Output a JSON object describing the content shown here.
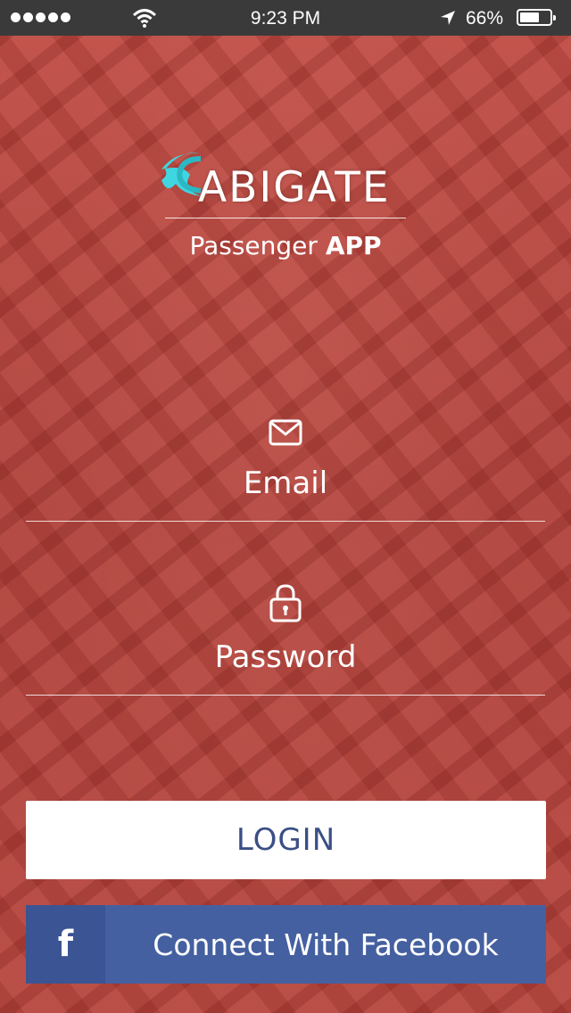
{
  "status_bar": {
    "time": "9:23 PM",
    "battery_percent": "66%",
    "battery_level": 0.66,
    "signal_icon": "signal-dots-icon",
    "wifi_icon": "wifi-icon",
    "location_icon": "location-arrow-icon"
  },
  "brand": {
    "logo_text": "ABIGATE",
    "logo_c_color": "#3fd6e0",
    "subtitle_regular": "Passenger ",
    "subtitle_bold": "APP"
  },
  "form": {
    "email": {
      "label": "Email",
      "icon": "envelope-icon"
    },
    "password": {
      "label": "Password",
      "icon": "lock-icon"
    }
  },
  "actions": {
    "login_label": "LOGIN",
    "facebook_icon_glyph": "f",
    "facebook_label": "Connect With Facebook"
  },
  "colors": {
    "background": "#b5453d",
    "login_text": "#3b4f85",
    "facebook": "#4560a0",
    "facebook_dark": "#3b5493"
  }
}
